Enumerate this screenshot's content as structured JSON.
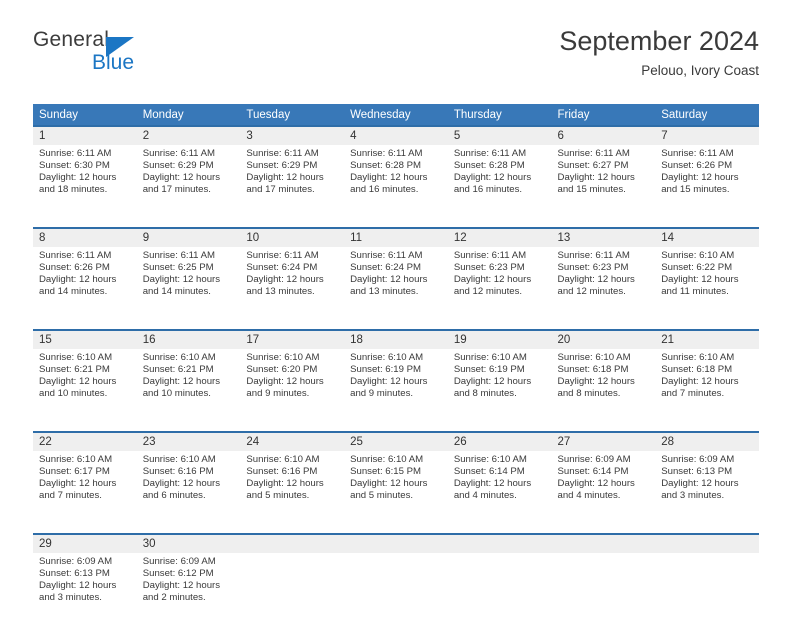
{
  "brand": {
    "name_part1": "General",
    "name_part2": "Blue",
    "triangle_icon": "triangle-icon"
  },
  "header": {
    "title": "September 2024",
    "subtitle": "Pelouo, Ivory Coast"
  },
  "colors": {
    "header_blue": "#3878b8",
    "rule_blue": "#2e6da8",
    "day_band": "#efefef",
    "brand_blue": "#1b76c4"
  },
  "weekdays": [
    "Sunday",
    "Monday",
    "Tuesday",
    "Wednesday",
    "Thursday",
    "Friday",
    "Saturday"
  ],
  "weeks": [
    [
      {
        "day": "1",
        "sunrise": "Sunrise: 6:11 AM",
        "sunset": "Sunset: 6:30 PM",
        "daylight1": "Daylight: 12 hours",
        "daylight2": "and 18 minutes."
      },
      {
        "day": "2",
        "sunrise": "Sunrise: 6:11 AM",
        "sunset": "Sunset: 6:29 PM",
        "daylight1": "Daylight: 12 hours",
        "daylight2": "and 17 minutes."
      },
      {
        "day": "3",
        "sunrise": "Sunrise: 6:11 AM",
        "sunset": "Sunset: 6:29 PM",
        "daylight1": "Daylight: 12 hours",
        "daylight2": "and 17 minutes."
      },
      {
        "day": "4",
        "sunrise": "Sunrise: 6:11 AM",
        "sunset": "Sunset: 6:28 PM",
        "daylight1": "Daylight: 12 hours",
        "daylight2": "and 16 minutes."
      },
      {
        "day": "5",
        "sunrise": "Sunrise: 6:11 AM",
        "sunset": "Sunset: 6:28 PM",
        "daylight1": "Daylight: 12 hours",
        "daylight2": "and 16 minutes."
      },
      {
        "day": "6",
        "sunrise": "Sunrise: 6:11 AM",
        "sunset": "Sunset: 6:27 PM",
        "daylight1": "Daylight: 12 hours",
        "daylight2": "and 15 minutes."
      },
      {
        "day": "7",
        "sunrise": "Sunrise: 6:11 AM",
        "sunset": "Sunset: 6:26 PM",
        "daylight1": "Daylight: 12 hours",
        "daylight2": "and 15 minutes."
      }
    ],
    [
      {
        "day": "8",
        "sunrise": "Sunrise: 6:11 AM",
        "sunset": "Sunset: 6:26 PM",
        "daylight1": "Daylight: 12 hours",
        "daylight2": "and 14 minutes."
      },
      {
        "day": "9",
        "sunrise": "Sunrise: 6:11 AM",
        "sunset": "Sunset: 6:25 PM",
        "daylight1": "Daylight: 12 hours",
        "daylight2": "and 14 minutes."
      },
      {
        "day": "10",
        "sunrise": "Sunrise: 6:11 AM",
        "sunset": "Sunset: 6:24 PM",
        "daylight1": "Daylight: 12 hours",
        "daylight2": "and 13 minutes."
      },
      {
        "day": "11",
        "sunrise": "Sunrise: 6:11 AM",
        "sunset": "Sunset: 6:24 PM",
        "daylight1": "Daylight: 12 hours",
        "daylight2": "and 13 minutes."
      },
      {
        "day": "12",
        "sunrise": "Sunrise: 6:11 AM",
        "sunset": "Sunset: 6:23 PM",
        "daylight1": "Daylight: 12 hours",
        "daylight2": "and 12 minutes."
      },
      {
        "day": "13",
        "sunrise": "Sunrise: 6:11 AM",
        "sunset": "Sunset: 6:23 PM",
        "daylight1": "Daylight: 12 hours",
        "daylight2": "and 12 minutes."
      },
      {
        "day": "14",
        "sunrise": "Sunrise: 6:10 AM",
        "sunset": "Sunset: 6:22 PM",
        "daylight1": "Daylight: 12 hours",
        "daylight2": "and 11 minutes."
      }
    ],
    [
      {
        "day": "15",
        "sunrise": "Sunrise: 6:10 AM",
        "sunset": "Sunset: 6:21 PM",
        "daylight1": "Daylight: 12 hours",
        "daylight2": "and 10 minutes."
      },
      {
        "day": "16",
        "sunrise": "Sunrise: 6:10 AM",
        "sunset": "Sunset: 6:21 PM",
        "daylight1": "Daylight: 12 hours",
        "daylight2": "and 10 minutes."
      },
      {
        "day": "17",
        "sunrise": "Sunrise: 6:10 AM",
        "sunset": "Sunset: 6:20 PM",
        "daylight1": "Daylight: 12 hours",
        "daylight2": "and 9 minutes."
      },
      {
        "day": "18",
        "sunrise": "Sunrise: 6:10 AM",
        "sunset": "Sunset: 6:19 PM",
        "daylight1": "Daylight: 12 hours",
        "daylight2": "and 9 minutes."
      },
      {
        "day": "19",
        "sunrise": "Sunrise: 6:10 AM",
        "sunset": "Sunset: 6:19 PM",
        "daylight1": "Daylight: 12 hours",
        "daylight2": "and 8 minutes."
      },
      {
        "day": "20",
        "sunrise": "Sunrise: 6:10 AM",
        "sunset": "Sunset: 6:18 PM",
        "daylight1": "Daylight: 12 hours",
        "daylight2": "and 8 minutes."
      },
      {
        "day": "21",
        "sunrise": "Sunrise: 6:10 AM",
        "sunset": "Sunset: 6:18 PM",
        "daylight1": "Daylight: 12 hours",
        "daylight2": "and 7 minutes."
      }
    ],
    [
      {
        "day": "22",
        "sunrise": "Sunrise: 6:10 AM",
        "sunset": "Sunset: 6:17 PM",
        "daylight1": "Daylight: 12 hours",
        "daylight2": "and 7 minutes."
      },
      {
        "day": "23",
        "sunrise": "Sunrise: 6:10 AM",
        "sunset": "Sunset: 6:16 PM",
        "daylight1": "Daylight: 12 hours",
        "daylight2": "and 6 minutes."
      },
      {
        "day": "24",
        "sunrise": "Sunrise: 6:10 AM",
        "sunset": "Sunset: 6:16 PM",
        "daylight1": "Daylight: 12 hours",
        "daylight2": "and 5 minutes."
      },
      {
        "day": "25",
        "sunrise": "Sunrise: 6:10 AM",
        "sunset": "Sunset: 6:15 PM",
        "daylight1": "Daylight: 12 hours",
        "daylight2": "and 5 minutes."
      },
      {
        "day": "26",
        "sunrise": "Sunrise: 6:10 AM",
        "sunset": "Sunset: 6:14 PM",
        "daylight1": "Daylight: 12 hours",
        "daylight2": "and 4 minutes."
      },
      {
        "day": "27",
        "sunrise": "Sunrise: 6:09 AM",
        "sunset": "Sunset: 6:14 PM",
        "daylight1": "Daylight: 12 hours",
        "daylight2": "and 4 minutes."
      },
      {
        "day": "28",
        "sunrise": "Sunrise: 6:09 AM",
        "sunset": "Sunset: 6:13 PM",
        "daylight1": "Daylight: 12 hours",
        "daylight2": "and 3 minutes."
      }
    ],
    [
      {
        "day": "29",
        "sunrise": "Sunrise: 6:09 AM",
        "sunset": "Sunset: 6:13 PM",
        "daylight1": "Daylight: 12 hours",
        "daylight2": "and 3 minutes."
      },
      {
        "day": "30",
        "sunrise": "Sunrise: 6:09 AM",
        "sunset": "Sunset: 6:12 PM",
        "daylight1": "Daylight: 12 hours",
        "daylight2": "and 2 minutes."
      },
      {
        "day": "",
        "sunrise": "",
        "sunset": "",
        "daylight1": "",
        "daylight2": ""
      },
      {
        "day": "",
        "sunrise": "",
        "sunset": "",
        "daylight1": "",
        "daylight2": ""
      },
      {
        "day": "",
        "sunrise": "",
        "sunset": "",
        "daylight1": "",
        "daylight2": ""
      },
      {
        "day": "",
        "sunrise": "",
        "sunset": "",
        "daylight1": "",
        "daylight2": ""
      },
      {
        "day": "",
        "sunrise": "",
        "sunset": "",
        "daylight1": "",
        "daylight2": ""
      }
    ]
  ]
}
